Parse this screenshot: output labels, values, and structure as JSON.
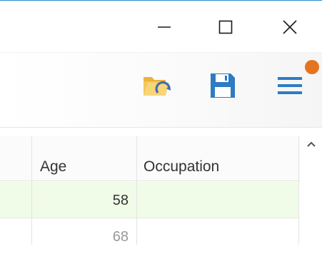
{
  "window": {
    "controls": {
      "minimize_icon": "minimize-icon",
      "maximize_icon": "maximize-icon",
      "close_icon": "close-icon"
    }
  },
  "toolbar": {
    "buttons": [
      {
        "id": "open",
        "icon": "folder-open-icon",
        "color": "#f2c14e"
      },
      {
        "id": "save",
        "icon": "save-icon",
        "color": "#2e7bc4"
      },
      {
        "id": "menu",
        "icon": "hamburger-menu-icon",
        "color": "#2e7bc4"
      }
    ],
    "notification_color": "#e57420"
  },
  "grid": {
    "columns": [
      {
        "id": "age",
        "label": "Age"
      },
      {
        "id": "occupation",
        "label": "Occupation"
      }
    ],
    "rows": [
      {
        "age": "58",
        "occupation": "",
        "highlighted": true
      },
      {
        "age": "68",
        "occupation": "",
        "highlighted": false
      }
    ],
    "highlight_color": "#f0fbe8"
  }
}
